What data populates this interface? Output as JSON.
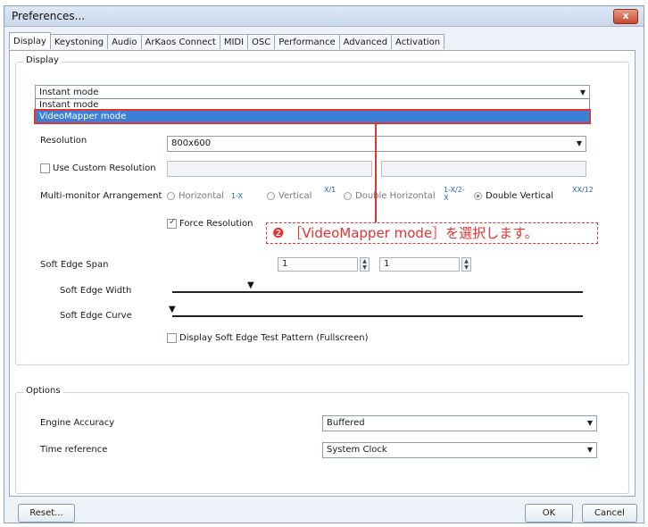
{
  "window": {
    "title": "Preferences...",
    "close_glyph": "x"
  },
  "tabs": [
    "Display",
    "Keystoning",
    "Audio",
    "ArKaos Connect",
    "MIDI",
    "OSC",
    "Performance",
    "Advanced",
    "Activation"
  ],
  "display": {
    "group_label": "Display",
    "mode_select": {
      "value": "Instant mode",
      "options": [
        "Instant mode",
        "VideoMapper mode"
      ]
    },
    "resolution": {
      "label": "Resolution",
      "value": "800x600"
    },
    "custom_resolution": {
      "label": "Use Custom Resolution",
      "checked": false
    },
    "multi_monitor": {
      "label": "Multi-monitor Arrangement",
      "options": [
        {
          "label": "Horizontal",
          "glyph": "1-X",
          "selected": false
        },
        {
          "label": "Vertical",
          "glyph": "X/1",
          "selected": false
        },
        {
          "label": "Double Horizontal",
          "glyph": "1-X/2-X",
          "selected": false
        },
        {
          "label": "Double Vertical",
          "glyph": "XX/12",
          "selected": true
        }
      ]
    },
    "force_resolution": {
      "label": "Force Resolution",
      "checked": true
    },
    "soft_edge_span": {
      "label": "Soft Edge Span",
      "value1": "1",
      "value2": "1"
    },
    "soft_edge_width": {
      "label": "Soft Edge Width"
    },
    "soft_edge_curve": {
      "label": "Soft Edge Curve"
    },
    "test_pattern": {
      "label": "Display Soft Edge Test Pattern (Fullscreen)",
      "checked": false
    }
  },
  "annotation": {
    "number": "❷",
    "text": "［VideoMapper mode］を選択します。"
  },
  "options": {
    "group_label": "Options",
    "engine_accuracy": {
      "label": "Engine Accuracy",
      "value": "Buffered"
    },
    "time_reference": {
      "label": "Time reference",
      "value": "System Clock"
    }
  },
  "buttons": {
    "reset": "Reset...",
    "ok": "OK",
    "cancel": "Cancel"
  },
  "colors": {
    "annotation": "#e53333",
    "selection": "#3b7fd6"
  }
}
